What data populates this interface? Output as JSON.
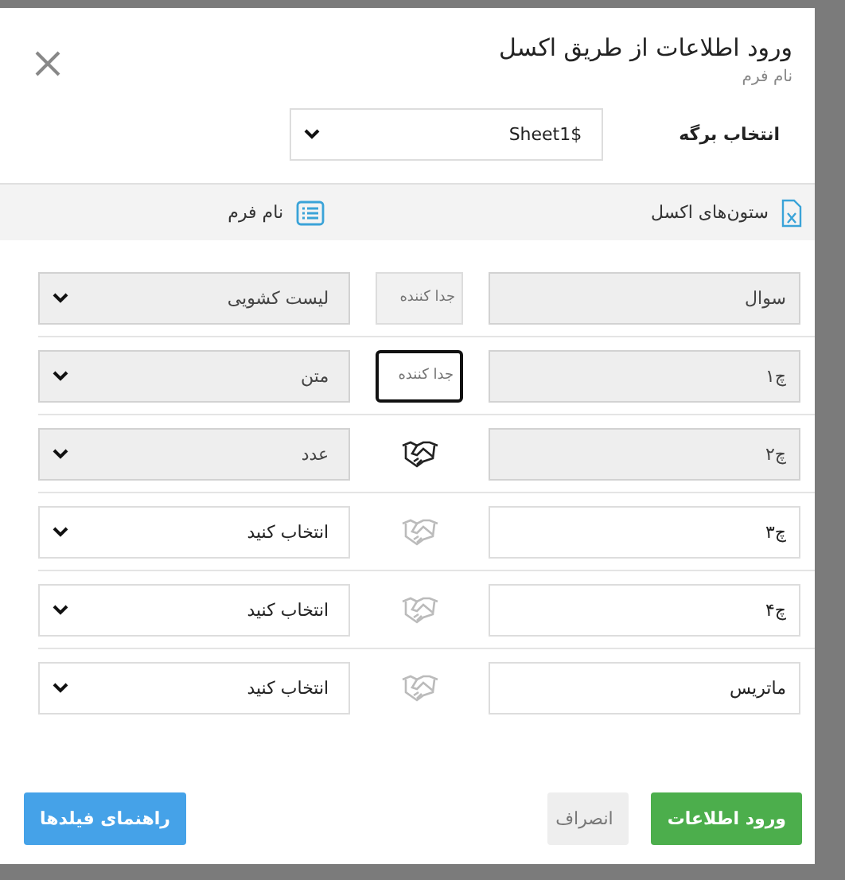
{
  "dialog": {
    "title": "ورود اطلاعات از طریق اکسل",
    "subtitle": "نام فرم"
  },
  "sheet": {
    "label": "انتخاب برگه",
    "value": "Sheet1$"
  },
  "table": {
    "columns": [
      {
        "label": "ستون‌های اکسل",
        "kind": "excel"
      },
      {
        "label": "نام فرم",
        "kind": "list"
      }
    ],
    "rows": [
      {
        "column": "سوال",
        "disabled": true,
        "kind": "separator",
        "separator": {
          "placeholder": "جدا کننده",
          "focused": false
        },
        "type": "لیست کشویی"
      },
      {
        "column": "چ۱",
        "disabled": true,
        "kind": "separator",
        "separator": {
          "placeholder": "جدا کننده",
          "focused": true
        },
        "type": "متن"
      },
      {
        "column": "چ۲",
        "disabled": true,
        "kind": "link",
        "linked": true,
        "type": "عدد"
      },
      {
        "column": "چ۳",
        "disabled": false,
        "kind": "link",
        "linked": false,
        "type": "انتخاب کنید"
      },
      {
        "column": "چ۴",
        "disabled": false,
        "kind": "link",
        "linked": false,
        "type": "انتخاب کنید"
      },
      {
        "column": "ماتریس",
        "disabled": false,
        "kind": "link",
        "linked": false,
        "type": "انتخاب کنید"
      }
    ]
  },
  "buttons": [
    {
      "label": "ورود اطلاعات",
      "kind": "primary"
    },
    {
      "label": "انصراف",
      "kind": "cancel"
    },
    {
      "label": "راهنمای فیلدها",
      "kind": "help"
    }
  ]
}
